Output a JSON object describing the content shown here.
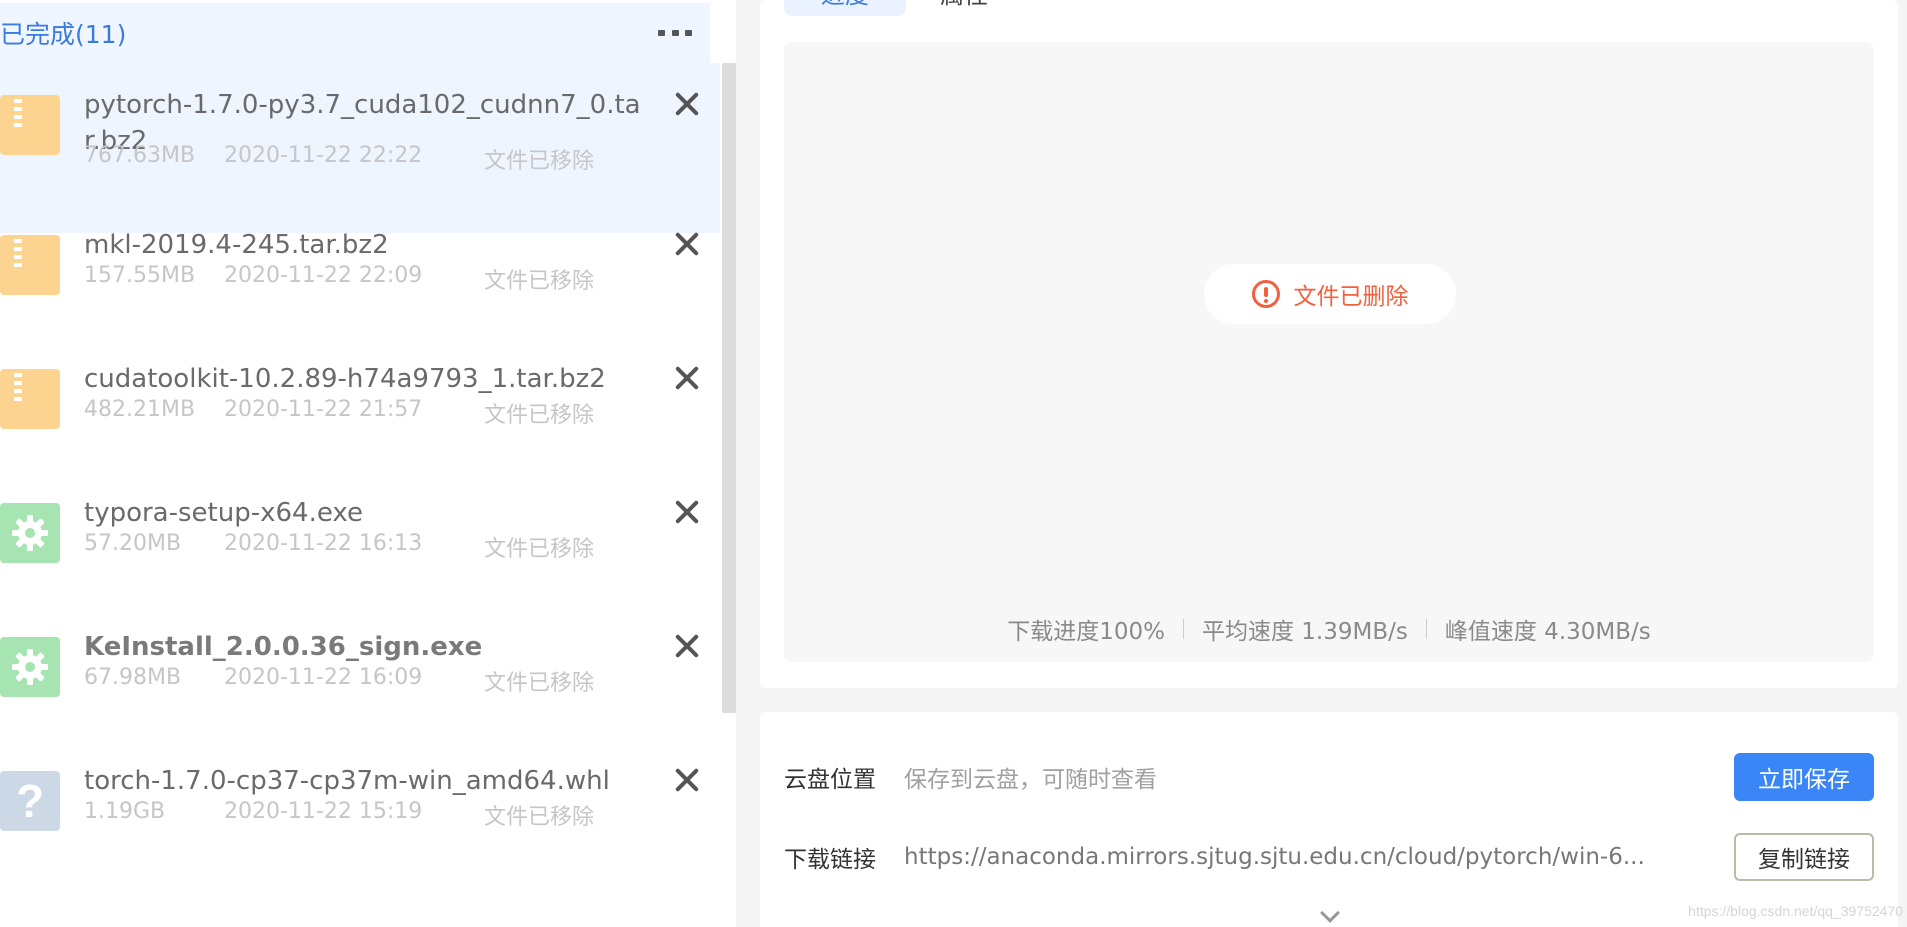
{
  "left_panel": {
    "header_title": "已完成(11)",
    "more_icon": "more-horizontal-icon",
    "items": [
      {
        "name": "pytorch-1.7.0-py3.7_cuda102_cudnn7_0.tar.bz2",
        "size": "767.63MB",
        "date": "2020-11-22 22:22",
        "status": "文件已移除",
        "icon": "zip-icon"
      },
      {
        "name": "mkl-2019.4-245.tar.bz2",
        "size": "157.55MB",
        "date": "2020-11-22 22:09",
        "status": "文件已移除",
        "icon": "zip-icon"
      },
      {
        "name": "cudatoolkit-10.2.89-h74a9793_1.tar.bz2",
        "size": "482.21MB",
        "date": "2020-11-22 21:57",
        "status": "文件已移除",
        "icon": "zip-icon"
      },
      {
        "name": "typora-setup-x64.exe",
        "size": "57.20MB",
        "date": "2020-11-22 16:13",
        "status": "文件已移除",
        "icon": "gear-icon"
      },
      {
        "name": "KeInstall_2.0.0.36_sign.exe",
        "size": "67.98MB",
        "date": "2020-11-22 16:09",
        "status": "文件已移除",
        "icon": "gear-icon"
      },
      {
        "name": "torch-1.7.0-cp37-cp37m-win_amd64.whl",
        "size": "1.19GB",
        "date": "2020-11-22 15:19",
        "status": "文件已移除",
        "icon": "question-icon",
        "icon_glyph": "?"
      }
    ]
  },
  "right_panel": {
    "tab_active": "进度",
    "tab_other": "属性",
    "deleted_message": "文件已删除",
    "stats": {
      "progress": "下载进度100%",
      "avg_speed": "平均速度 1.39MB/s",
      "peak_speed": "峰值速度 4.30MB/s"
    },
    "cloud": {
      "label": "云盘位置",
      "value": "保存到云盘，可随时查看",
      "button": "立即保存"
    },
    "link": {
      "label": "下载链接",
      "value": "https://anaconda.mirrors.sjtug.sjtu.edu.cn/cloud/pytorch/win-6...",
      "button": "复制链接"
    }
  },
  "colors": {
    "accent": "#3a86f7",
    "warning": "#f2603d",
    "selected_row": "#eef5ff"
  },
  "watermark": "https://blog.csdn.net/qq_39752470"
}
